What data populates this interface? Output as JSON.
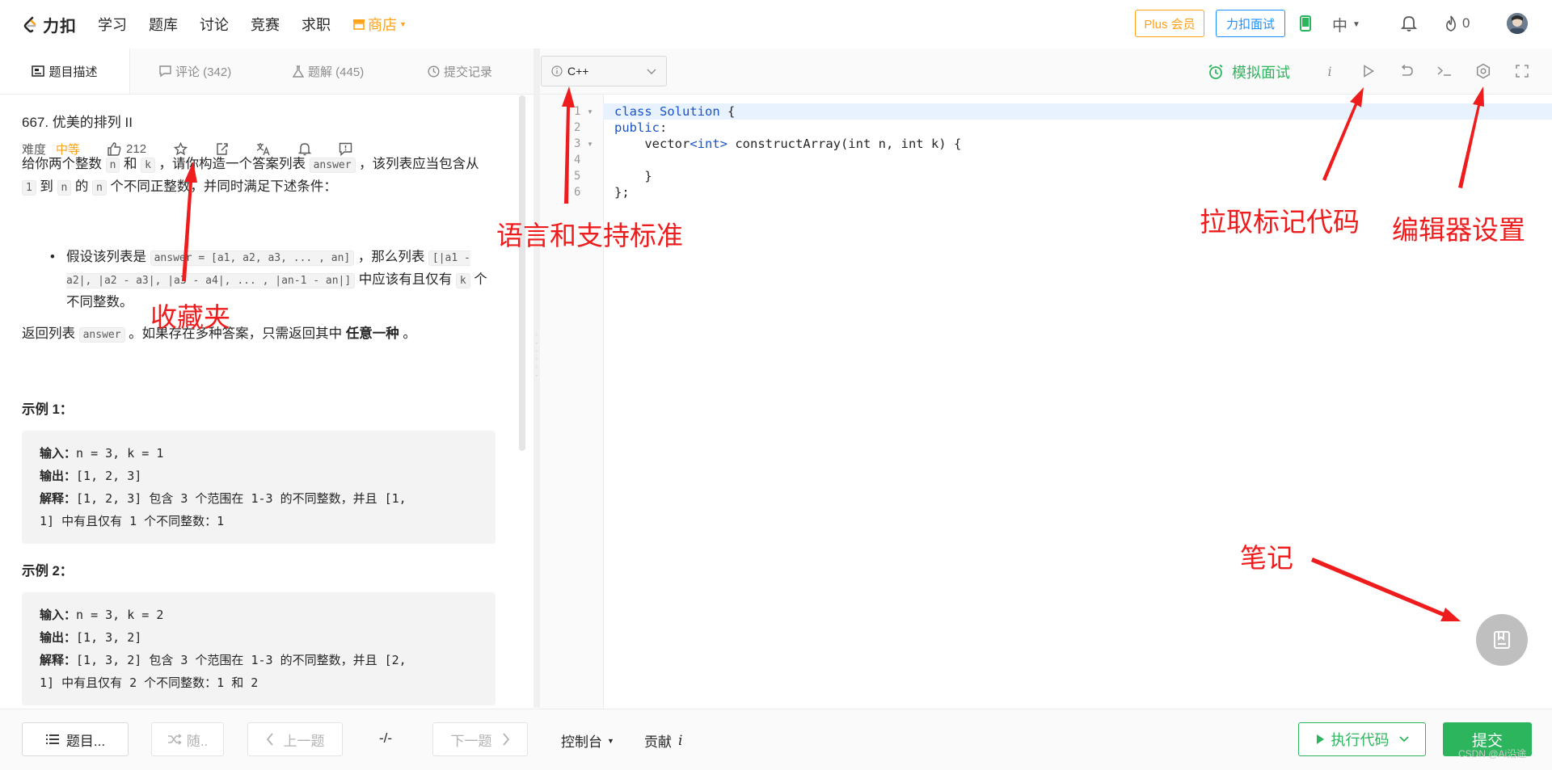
{
  "nav": {
    "logo_text": "力扣",
    "links": [
      "学习",
      "题库",
      "讨论",
      "竞赛",
      "求职"
    ],
    "store": "商店",
    "plus_label": "Plus 会员",
    "interview_label": "力扣面试",
    "lang": "中",
    "points": "0",
    "colors": {
      "brand": "#ffa116",
      "blue": "#1a90ff",
      "green": "#2db55d"
    }
  },
  "tabs": [
    {
      "label": "题目描述",
      "icon": "description-icon"
    },
    {
      "label": "评论 (342)",
      "icon": "comment-icon"
    },
    {
      "label": "题解 (445)",
      "icon": "flask-icon"
    },
    {
      "label": "提交记录",
      "icon": "clock-icon"
    }
  ],
  "problem": {
    "title": "667. 优美的排列 II",
    "difficulty_label": "难度",
    "difficulty": "中等",
    "likes": "212",
    "intro": {
      "t1": "给你两个整数 ",
      "c1": "n",
      "t2": " 和 ",
      "c2": "k",
      "t3": " ，请你构造一个答案列表 ",
      "c3": "answer",
      "t4": " ，该列表应当包含从 ",
      "c4": "1",
      "t5": " 到 ",
      "c5": "n",
      "t6": " 的 ",
      "c6": "n",
      "t7": " 个不同正整数，并同时满足下述条件："
    },
    "bullet": {
      "t1": "假设该列表是 ",
      "c1": "answer = [a1, a2, a3, ... , an]",
      "t2": " ，那么列表 ",
      "c2": "[|a1 - a2|, |a2 - a3|, |a3 - a4|, ... , |an-1 - an|]",
      "t3": " 中应该有且仅有 ",
      "c3": "k",
      "t4": " 个不同整数。"
    },
    "ret": {
      "t1": "返回列表 ",
      "c1": "answer",
      "t2": " 。如果存在多种答案，只需返回其中 ",
      "b1": "任意一种",
      "t3": " 。"
    },
    "examples": [
      {
        "heading": "示例 1：",
        "in_label": "输入：",
        "input": "n = 3, k = 1",
        "out_label": "输出：",
        "output": "[1, 2, 3]",
        "exp_label": "解释：",
        "exp1": "[1, 2, 3] 包含 3 个范围在 1-3 的不同整数，并且 [1,",
        "exp2": "1] 中有且仅有 1 个不同整数：1"
      },
      {
        "heading": "示例 2：",
        "in_label": "输入：",
        "input": "n = 3, k = 2",
        "out_label": "输出：",
        "output": "[1, 3, 2]",
        "exp_label": "解释：",
        "exp1": "[1, 3, 2] 包含 3 个范围在 1-3 的不同整数，并且 [2,",
        "exp2": "1] 中有且仅有 2 个不同整数：1 和 2"
      }
    ]
  },
  "editor": {
    "language": "C++",
    "mock_interview": "模拟面试",
    "line_numbers": [
      "1",
      "2",
      "3",
      "4",
      "5",
      "6"
    ],
    "code": {
      "l1_kw": "class",
      "l1_name": "Solution",
      "l1_rest": " {",
      "l2_kw": "public",
      "l2_rest": ":",
      "l3_a": "    vector",
      "l3_b": "<int>",
      "l3_c": " constructArray(int n, int k) {",
      "l4": "",
      "l5": "    }",
      "l6": "};"
    }
  },
  "bottom": {
    "problem_list": "题目...",
    "random": "随..",
    "prev": "上一题",
    "page": "-/-",
    "next": "下一题",
    "console": "控制台",
    "contribute": "贡献",
    "run": "执行代码",
    "submit": "提交",
    "watermark": "CSDN @Ai沿途"
  },
  "annotations": {
    "favorites": "收藏夹",
    "language": "语言和支持标准",
    "pull_code": "拉取标记代码",
    "settings": "编辑器设置",
    "notes": "笔记",
    "color": "#ee1c1c"
  }
}
